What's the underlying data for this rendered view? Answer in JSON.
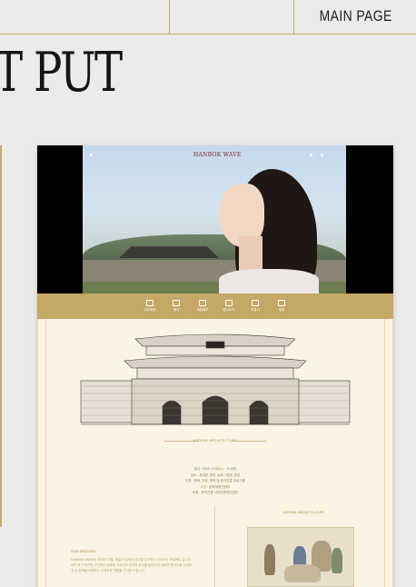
{
  "header": {
    "main_page_label": "MAIN PAGE",
    "big_title": "T PUT"
  },
  "site": {
    "brand": "HANBOK WAVE",
    "nav_links": [
      "",
      "",
      "",
      ""
    ],
    "menu": [
      {
        "label": "교육과정",
        "icon": "book-icon"
      },
      {
        "label": "행사",
        "icon": "lantern-icon"
      },
      {
        "label": "체험예약",
        "icon": "calendar-icon"
      },
      {
        "label": "행사소식",
        "icon": "bell-icon"
      },
      {
        "label": "커뮤니",
        "icon": "chat-icon"
      },
      {
        "label": "채용",
        "icon": "file-icon"
      }
    ],
    "architecture_caption": "KOREAN ARCHITECTURE",
    "info_lines": [
      "일시 : 2022. 5.25(수) ~ 6.2(목)",
      "장소 : 동대문 광장, 숭례 그림판 광장",
      "주최 : 문화, 관광, 체육 및 한국전통 무료그룹",
      "주관 : 문화재청관광부",
      "후원 : 한국관광 나라전원재단법인"
    ],
    "culture_caption": "KOREAN UNIQUE CULTURE",
    "mission_heading": "OUR MISSION",
    "mission_text": "HANBOK WAVE는 한국의 전통, 예술의 섬세한 감각을 추구하고 지켜가는 프로젝트 입니다. 모든 후기 하기만 고전적인 문화와 자세대의 우리의 한국을 알리려고 새로운 방식으로 주재하게 된 한복을 이해하는 다채로운 경험을 선사한 드립니다."
  },
  "colors": {
    "gold": "#c5a865",
    "cream": "#fbf4e4",
    "brand_red": "#7a1b1b"
  }
}
